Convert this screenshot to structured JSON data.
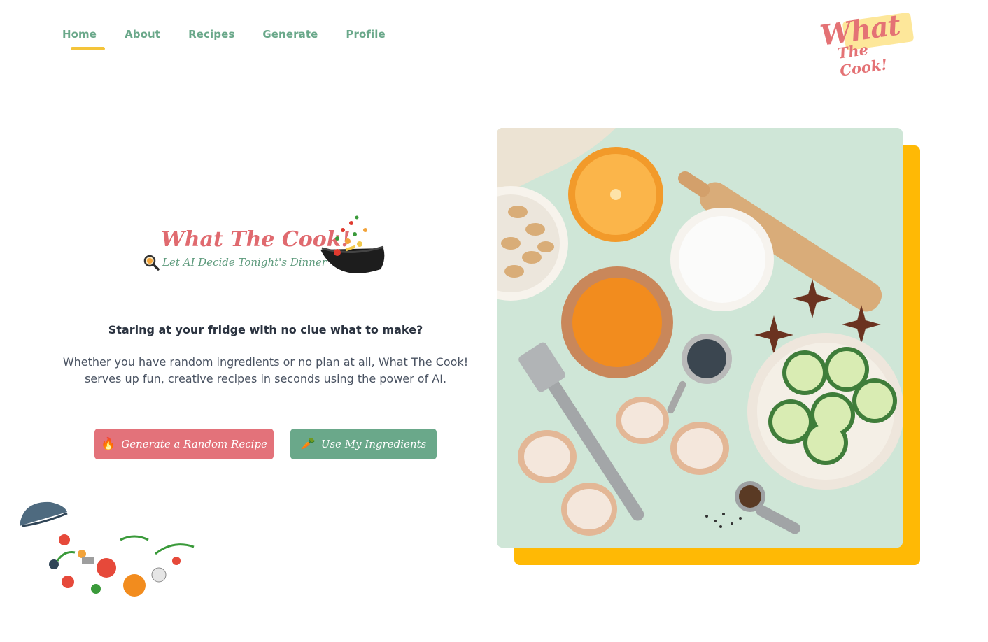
{
  "nav": {
    "items": [
      {
        "label": "Home",
        "active": true
      },
      {
        "label": "About",
        "active": false
      },
      {
        "label": "Recipes",
        "active": false
      },
      {
        "label": "Generate",
        "active": false
      },
      {
        "label": "Profile",
        "active": false
      }
    ]
  },
  "logo": {
    "line1": "What",
    "line2": "The Cook!"
  },
  "hero": {
    "brand_title": "What The Cook!",
    "brand_tagline": "Let AI Decide Tonight's Dinner",
    "heading": "Staring at your fridge with no clue what to make?",
    "description": "Whether you have random ingredients or no plan at all, What The Cook! serves up fun, creative recipes in seconds using the power of AI.",
    "buttons": {
      "random_icon": "🔥",
      "random_label": "Generate a Random Recipe",
      "ingredients_icon": "🥕",
      "ingredients_label": "Use My Ingredients"
    }
  },
  "colors": {
    "accent_green": "#6aa88a",
    "accent_red": "#e3727a",
    "accent_yellow": "#ffb905",
    "underline": "#f4c43a"
  },
  "icons": [
    "magnifier-icon",
    "wok-icon",
    "fire-icon",
    "carrot-icon"
  ]
}
